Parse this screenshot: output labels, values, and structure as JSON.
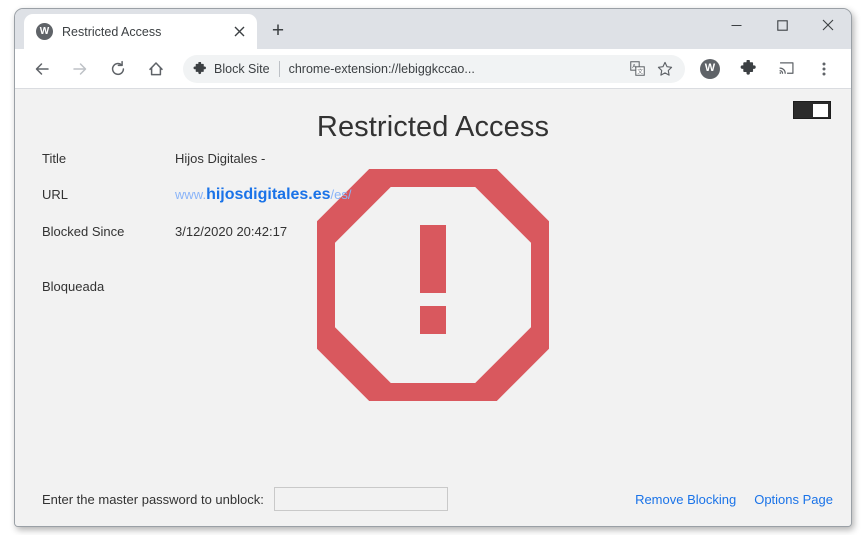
{
  "browser": {
    "tab": {
      "title": "Restricted Access",
      "favicon_letter": "W",
      "favicon_icon": "circle-w-icon",
      "close_icon": "close-icon"
    },
    "new_tab_label": "+",
    "window_controls": {
      "minimize": "minimize-icon",
      "maximize": "maximize-icon",
      "close": "close-icon"
    },
    "toolbar": {
      "back_icon": "back-arrow-icon",
      "forward_icon": "forward-arrow-icon",
      "reload_icon": "reload-icon",
      "home_icon": "home-icon",
      "extension_chip_label": "Block Site",
      "extension_chip_icon": "puzzle-piece-icon",
      "url": "chrome-extension://lebiggkccao...",
      "translate_icon": "translate-icon",
      "bookmark_icon": "star-icon",
      "profile_avatar_letter": "W",
      "extensions_icon": "puzzle-piece-icon",
      "cast_icon": "cast-icon",
      "menu_icon": "three-dot-menu-icon"
    }
  },
  "page": {
    "heading": "Restricted Access",
    "toggle": {
      "name": "dark-mode-toggle",
      "state": "on"
    },
    "info_rows": [
      {
        "label": "Title",
        "value": "Hijos Digitales -"
      },
      {
        "label": "URL",
        "value": "www.hijosdigitales.es/es/"
      },
      {
        "label": "Blocked Since",
        "value": "3/12/2020 20:42:17"
      }
    ],
    "url_parts": {
      "prefix": "www.",
      "domain": "hijosdigitales.es",
      "path": "/es/"
    },
    "status_text": "Bloqueada",
    "stop_sign": {
      "name": "stop-sign-warning-icon",
      "color": "#d9585e"
    },
    "footer": {
      "password_label": "Enter the master password to unblock:",
      "password_value": "",
      "password_placeholder": "",
      "links": [
        {
          "label": "Remove Blocking"
        },
        {
          "label": "Options Page"
        }
      ]
    }
  }
}
